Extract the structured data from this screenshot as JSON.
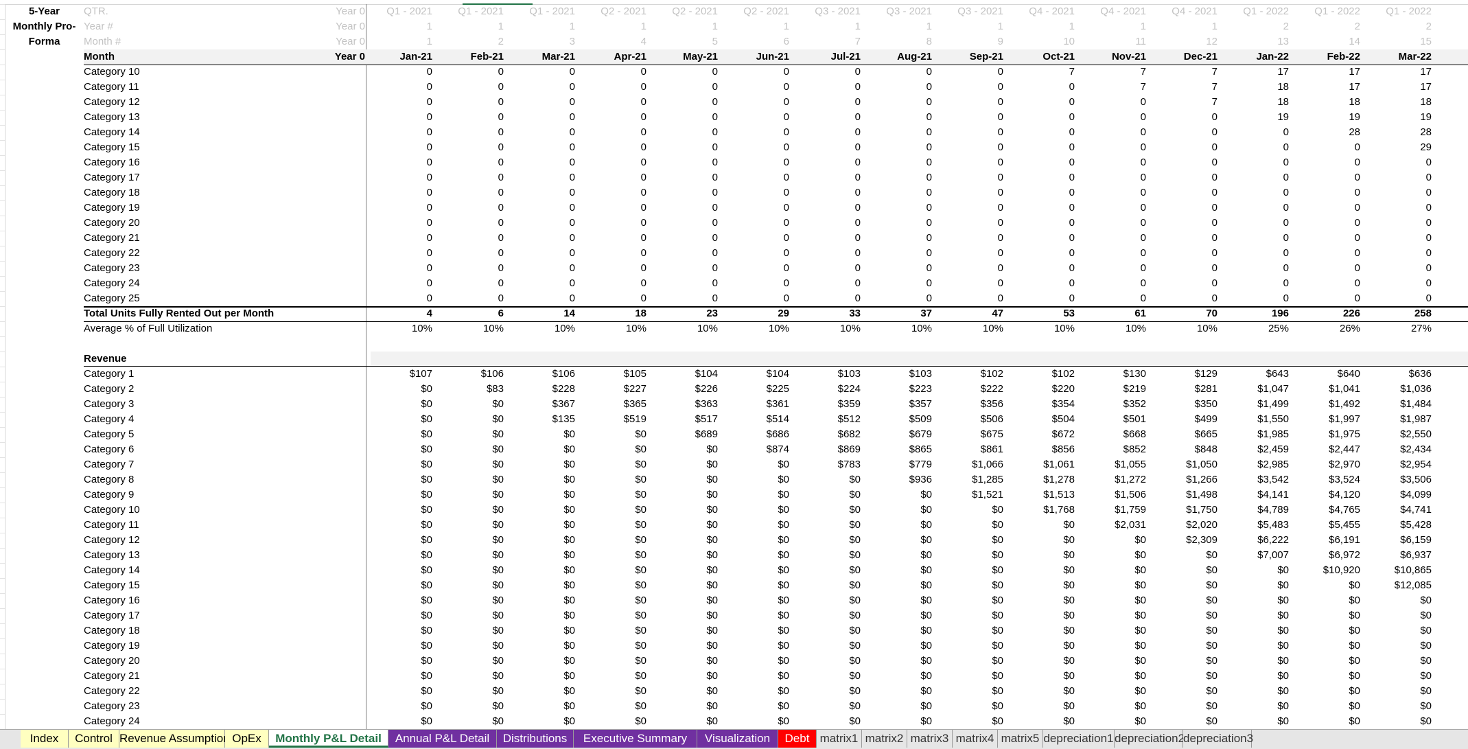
{
  "title": [
    "5-Year",
    "Monthly Pro-",
    "Forma"
  ],
  "header_rows": [
    {
      "label": "QTR.",
      "year0": "Year 0",
      "values": [
        "Q1 - 2021",
        "Q1 - 2021",
        "Q1 - 2021",
        "Q2 - 2021",
        "Q2 - 2021",
        "Q2 - 2021",
        "Q3 - 2021",
        "Q3 - 2021",
        "Q3 - 2021",
        "Q4 - 2021",
        "Q4 - 2021",
        "Q4 - 2021",
        "Q1 - 2022",
        "Q1 - 2022",
        "Q1 - 2022"
      ]
    },
    {
      "label": "Year #",
      "year0": "Year 0",
      "values": [
        "1",
        "1",
        "1",
        "1",
        "1",
        "1",
        "1",
        "1",
        "1",
        "1",
        "1",
        "1",
        "2",
        "2",
        "2"
      ]
    },
    {
      "label": "Month #",
      "year0": "Year 0",
      "values": [
        "1",
        "2",
        "3",
        "4",
        "5",
        "6",
        "7",
        "8",
        "9",
        "10",
        "11",
        "12",
        "13",
        "14",
        "15"
      ]
    }
  ],
  "month_row": {
    "label": "Month",
    "year0": "Year 0",
    "values": [
      "Jan-21",
      "Feb-21",
      "Mar-21",
      "Apr-21",
      "May-21",
      "Jun-21",
      "Jul-21",
      "Aug-21",
      "Sep-21",
      "Oct-21",
      "Nov-21",
      "Dec-21",
      "Jan-22",
      "Feb-22",
      "Mar-22"
    ]
  },
  "units_rows": [
    {
      "label": "Category 10",
      "values": [
        "0",
        "0",
        "0",
        "0",
        "0",
        "0",
        "0",
        "0",
        "0",
        "7",
        "7",
        "7",
        "17",
        "17",
        "17"
      ]
    },
    {
      "label": "Category 11",
      "values": [
        "0",
        "0",
        "0",
        "0",
        "0",
        "0",
        "0",
        "0",
        "0",
        "0",
        "7",
        "7",
        "18",
        "17",
        "17"
      ]
    },
    {
      "label": "Category 12",
      "values": [
        "0",
        "0",
        "0",
        "0",
        "0",
        "0",
        "0",
        "0",
        "0",
        "0",
        "0",
        "7",
        "18",
        "18",
        "18"
      ]
    },
    {
      "label": "Category 13",
      "values": [
        "0",
        "0",
        "0",
        "0",
        "0",
        "0",
        "0",
        "0",
        "0",
        "0",
        "0",
        "0",
        "19",
        "19",
        "19"
      ]
    },
    {
      "label": "Category 14",
      "values": [
        "0",
        "0",
        "0",
        "0",
        "0",
        "0",
        "0",
        "0",
        "0",
        "0",
        "0",
        "0",
        "0",
        "28",
        "28"
      ]
    },
    {
      "label": "Category 15",
      "values": [
        "0",
        "0",
        "0",
        "0",
        "0",
        "0",
        "0",
        "0",
        "0",
        "0",
        "0",
        "0",
        "0",
        "0",
        "29"
      ]
    },
    {
      "label": "Category 16",
      "values": [
        "0",
        "0",
        "0",
        "0",
        "0",
        "0",
        "0",
        "0",
        "0",
        "0",
        "0",
        "0",
        "0",
        "0",
        "0"
      ]
    },
    {
      "label": "Category 17",
      "values": [
        "0",
        "0",
        "0",
        "0",
        "0",
        "0",
        "0",
        "0",
        "0",
        "0",
        "0",
        "0",
        "0",
        "0",
        "0"
      ]
    },
    {
      "label": "Category 18",
      "values": [
        "0",
        "0",
        "0",
        "0",
        "0",
        "0",
        "0",
        "0",
        "0",
        "0",
        "0",
        "0",
        "0",
        "0",
        "0"
      ]
    },
    {
      "label": "Category 19",
      "values": [
        "0",
        "0",
        "0",
        "0",
        "0",
        "0",
        "0",
        "0",
        "0",
        "0",
        "0",
        "0",
        "0",
        "0",
        "0"
      ]
    },
    {
      "label": "Category 20",
      "values": [
        "0",
        "0",
        "0",
        "0",
        "0",
        "0",
        "0",
        "0",
        "0",
        "0",
        "0",
        "0",
        "0",
        "0",
        "0"
      ]
    },
    {
      "label": "Category 21",
      "values": [
        "0",
        "0",
        "0",
        "0",
        "0",
        "0",
        "0",
        "0",
        "0",
        "0",
        "0",
        "0",
        "0",
        "0",
        "0"
      ]
    },
    {
      "label": "Category 22",
      "values": [
        "0",
        "0",
        "0",
        "0",
        "0",
        "0",
        "0",
        "0",
        "0",
        "0",
        "0",
        "0",
        "0",
        "0",
        "0"
      ]
    },
    {
      "label": "Category 23",
      "values": [
        "0",
        "0",
        "0",
        "0",
        "0",
        "0",
        "0",
        "0",
        "0",
        "0",
        "0",
        "0",
        "0",
        "0",
        "0"
      ]
    },
    {
      "label": "Category 24",
      "values": [
        "0",
        "0",
        "0",
        "0",
        "0",
        "0",
        "0",
        "0",
        "0",
        "0",
        "0",
        "0",
        "0",
        "0",
        "0"
      ]
    },
    {
      "label": "Category 25",
      "values": [
        "0",
        "0",
        "0",
        "0",
        "0",
        "0",
        "0",
        "0",
        "0",
        "0",
        "0",
        "0",
        "0",
        "0",
        "0"
      ]
    }
  ],
  "total_units": {
    "label": "Total Units Fully Rented Out per Month",
    "values": [
      "4",
      "6",
      "14",
      "18",
      "23",
      "29",
      "33",
      "37",
      "47",
      "53",
      "61",
      "70",
      "196",
      "226",
      "258"
    ]
  },
  "avg_util": {
    "label": "Average % of Full Utilization",
    "values": [
      "10%",
      "10%",
      "10%",
      "10%",
      "10%",
      "10%",
      "10%",
      "10%",
      "10%",
      "10%",
      "10%",
      "10%",
      "25%",
      "26%",
      "27%"
    ]
  },
  "revenue_header": "Revenue",
  "revenue_rows": [
    {
      "label": "Category 1",
      "values": [
        "$107",
        "$106",
        "$106",
        "$105",
        "$104",
        "$104",
        "$103",
        "$103",
        "$102",
        "$102",
        "$130",
        "$129",
        "$643",
        "$640",
        "$636"
      ]
    },
    {
      "label": "Category 2",
      "values": [
        "$0",
        "$83",
        "$228",
        "$227",
        "$226",
        "$225",
        "$224",
        "$223",
        "$222",
        "$220",
        "$219",
        "$281",
        "$1,047",
        "$1,041",
        "$1,036"
      ]
    },
    {
      "label": "Category 3",
      "values": [
        "$0",
        "$0",
        "$367",
        "$365",
        "$363",
        "$361",
        "$359",
        "$357",
        "$356",
        "$354",
        "$352",
        "$350",
        "$1,499",
        "$1,492",
        "$1,484"
      ]
    },
    {
      "label": "Category 4",
      "values": [
        "$0",
        "$0",
        "$135",
        "$519",
        "$517",
        "$514",
        "$512",
        "$509",
        "$506",
        "$504",
        "$501",
        "$499",
        "$1,550",
        "$1,997",
        "$1,987"
      ]
    },
    {
      "label": "Category 5",
      "values": [
        "$0",
        "$0",
        "$0",
        "$0",
        "$689",
        "$686",
        "$682",
        "$679",
        "$675",
        "$672",
        "$668",
        "$665",
        "$1,985",
        "$1,975",
        "$2,550"
      ]
    },
    {
      "label": "Category 6",
      "values": [
        "$0",
        "$0",
        "$0",
        "$0",
        "$0",
        "$874",
        "$869",
        "$865",
        "$861",
        "$856",
        "$852",
        "$848",
        "$2,459",
        "$2,447",
        "$2,434"
      ]
    },
    {
      "label": "Category 7",
      "values": [
        "$0",
        "$0",
        "$0",
        "$0",
        "$0",
        "$0",
        "$783",
        "$779",
        "$1,066",
        "$1,061",
        "$1,055",
        "$1,050",
        "$2,985",
        "$2,970",
        "$2,954"
      ]
    },
    {
      "label": "Category 8",
      "values": [
        "$0",
        "$0",
        "$0",
        "$0",
        "$0",
        "$0",
        "$0",
        "$936",
        "$1,285",
        "$1,278",
        "$1,272",
        "$1,266",
        "$3,542",
        "$3,524",
        "$3,506"
      ]
    },
    {
      "label": "Category 9",
      "values": [
        "$0",
        "$0",
        "$0",
        "$0",
        "$0",
        "$0",
        "$0",
        "$0",
        "$1,521",
        "$1,513",
        "$1,506",
        "$1,498",
        "$4,141",
        "$4,120",
        "$4,099"
      ]
    },
    {
      "label": "Category 10",
      "values": [
        "$0",
        "$0",
        "$0",
        "$0",
        "$0",
        "$0",
        "$0",
        "$0",
        "$0",
        "$1,768",
        "$1,759",
        "$1,750",
        "$4,789",
        "$4,765",
        "$4,741"
      ]
    },
    {
      "label": "Category 11",
      "values": [
        "$0",
        "$0",
        "$0",
        "$0",
        "$0",
        "$0",
        "$0",
        "$0",
        "$0",
        "$0",
        "$2,031",
        "$2,020",
        "$5,483",
        "$5,455",
        "$5,428"
      ]
    },
    {
      "label": "Category 12",
      "values": [
        "$0",
        "$0",
        "$0",
        "$0",
        "$0",
        "$0",
        "$0",
        "$0",
        "$0",
        "$0",
        "$0",
        "$2,309",
        "$6,222",
        "$6,191",
        "$6,159"
      ]
    },
    {
      "label": "Category 13",
      "values": [
        "$0",
        "$0",
        "$0",
        "$0",
        "$0",
        "$0",
        "$0",
        "$0",
        "$0",
        "$0",
        "$0",
        "$0",
        "$7,007",
        "$6,972",
        "$6,937"
      ]
    },
    {
      "label": "Category 14",
      "values": [
        "$0",
        "$0",
        "$0",
        "$0",
        "$0",
        "$0",
        "$0",
        "$0",
        "$0",
        "$0",
        "$0",
        "$0",
        "$0",
        "$10,920",
        "$10,865"
      ]
    },
    {
      "label": "Category 15",
      "values": [
        "$0",
        "$0",
        "$0",
        "$0",
        "$0",
        "$0",
        "$0",
        "$0",
        "$0",
        "$0",
        "$0",
        "$0",
        "$0",
        "$0",
        "$12,085"
      ]
    },
    {
      "label": "Category 16",
      "values": [
        "$0",
        "$0",
        "$0",
        "$0",
        "$0",
        "$0",
        "$0",
        "$0",
        "$0",
        "$0",
        "$0",
        "$0",
        "$0",
        "$0",
        "$0"
      ]
    },
    {
      "label": "Category 17",
      "values": [
        "$0",
        "$0",
        "$0",
        "$0",
        "$0",
        "$0",
        "$0",
        "$0",
        "$0",
        "$0",
        "$0",
        "$0",
        "$0",
        "$0",
        "$0"
      ]
    },
    {
      "label": "Category 18",
      "values": [
        "$0",
        "$0",
        "$0",
        "$0",
        "$0",
        "$0",
        "$0",
        "$0",
        "$0",
        "$0",
        "$0",
        "$0",
        "$0",
        "$0",
        "$0"
      ]
    },
    {
      "label": "Category 19",
      "values": [
        "$0",
        "$0",
        "$0",
        "$0",
        "$0",
        "$0",
        "$0",
        "$0",
        "$0",
        "$0",
        "$0",
        "$0",
        "$0",
        "$0",
        "$0"
      ]
    },
    {
      "label": "Category 20",
      "values": [
        "$0",
        "$0",
        "$0",
        "$0",
        "$0",
        "$0",
        "$0",
        "$0",
        "$0",
        "$0",
        "$0",
        "$0",
        "$0",
        "$0",
        "$0"
      ]
    },
    {
      "label": "Category 21",
      "values": [
        "$0",
        "$0",
        "$0",
        "$0",
        "$0",
        "$0",
        "$0",
        "$0",
        "$0",
        "$0",
        "$0",
        "$0",
        "$0",
        "$0",
        "$0"
      ]
    },
    {
      "label": "Category 22",
      "values": [
        "$0",
        "$0",
        "$0",
        "$0",
        "$0",
        "$0",
        "$0",
        "$0",
        "$0",
        "$0",
        "$0",
        "$0",
        "$0",
        "$0",
        "$0"
      ]
    },
    {
      "label": "Category 23",
      "values": [
        "$0",
        "$0",
        "$0",
        "$0",
        "$0",
        "$0",
        "$0",
        "$0",
        "$0",
        "$0",
        "$0",
        "$0",
        "$0",
        "$0",
        "$0"
      ]
    },
    {
      "label": "Category 24",
      "values": [
        "$0",
        "$0",
        "$0",
        "$0",
        "$0",
        "$0",
        "$0",
        "$0",
        "$0",
        "$0",
        "$0",
        "$0",
        "$0",
        "$0",
        "$0"
      ]
    }
  ],
  "tabs": [
    {
      "label": "Index",
      "style": "yellow"
    },
    {
      "label": "Control",
      "style": "yellow"
    },
    {
      "label": "Revenue Assumptions",
      "style": "yellow"
    },
    {
      "label": "OpEx",
      "style": "yellow"
    },
    {
      "label": "Monthly P&L Detail",
      "style": "active"
    },
    {
      "label": "Annual P&L Detail",
      "style": "purple"
    },
    {
      "label": "Distributions",
      "style": "purple"
    },
    {
      "label": "Executive Summary",
      "style": "purple"
    },
    {
      "label": "Visualization",
      "style": "purple"
    },
    {
      "label": "Debt",
      "style": "red"
    },
    {
      "label": "matrix1",
      "style": "plain"
    },
    {
      "label": "matrix2",
      "style": "plain"
    },
    {
      "label": "matrix3",
      "style": "plain"
    },
    {
      "label": "matrix4",
      "style": "plain"
    },
    {
      "label": "matrix5",
      "style": "plain"
    },
    {
      "label": "depreciation1",
      "style": "plain"
    },
    {
      "label": "depreciation2",
      "style": "plain"
    },
    {
      "label": "depreciation3",
      "style": "plain"
    }
  ]
}
